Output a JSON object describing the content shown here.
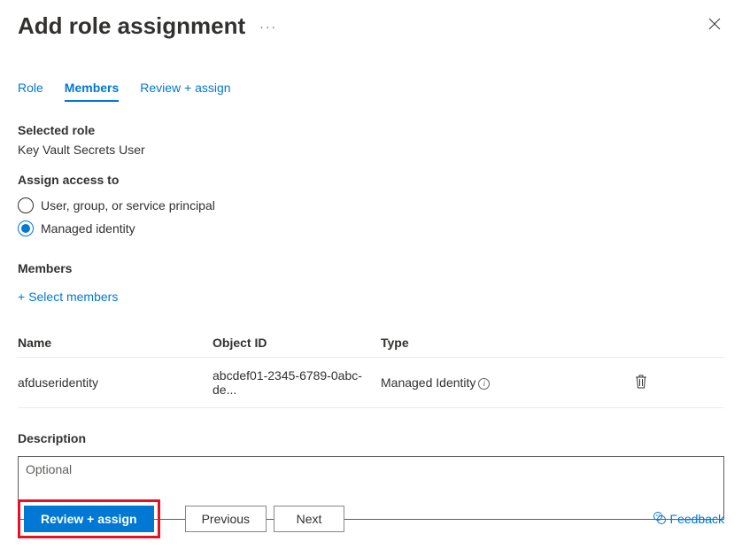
{
  "header": {
    "title": "Add role assignment"
  },
  "tabs": {
    "role": "Role",
    "members": "Members",
    "review": "Review + assign",
    "active": "members"
  },
  "selectedRole": {
    "label": "Selected role",
    "value": "Key Vault Secrets User"
  },
  "assignAccess": {
    "label": "Assign access to",
    "options": {
      "userGroup": "User, group, or service principal",
      "managedIdentity": "Managed identity"
    },
    "selected": "managedIdentity"
  },
  "members": {
    "label": "Members",
    "selectLink": "Select members",
    "columns": {
      "name": "Name",
      "objectId": "Object ID",
      "type": "Type"
    },
    "rows": [
      {
        "name": "afduseridentity",
        "objectId": "abcdef01-2345-6789-0abc-de...",
        "type": "Managed Identity"
      }
    ]
  },
  "description": {
    "label": "Description",
    "placeholder": "Optional",
    "value": ""
  },
  "footer": {
    "reviewAssign": "Review + assign",
    "previous": "Previous",
    "next": "Next",
    "feedback": "Feedback"
  }
}
